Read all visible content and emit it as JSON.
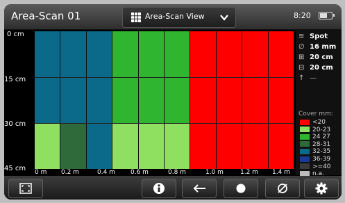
{
  "title": "Area-Scan 01",
  "view_selector": {
    "label": "Area-Scan View"
  },
  "status": {
    "time": "8:20"
  },
  "y_axis": {
    "labels": [
      "0 cm",
      "15 cm",
      "30 cm",
      "45 cm"
    ]
  },
  "x_axis": {
    "labels": [
      "0 m",
      "0.2 m",
      "0.4 m",
      "0.6 m",
      "0.8 m",
      "1.0 m",
      "1.2 m",
      "1.4 m"
    ]
  },
  "info_panel": {
    "mode": "Spot",
    "diameter": "16 mm",
    "height": "20 cm",
    "width": "20 cm",
    "arrow_value": "—"
  },
  "legend": {
    "title": "Cover mm:",
    "items": [
      {
        "label": "<20",
        "color": "#ff0000"
      },
      {
        "label": "20-23",
        "color": "#8fe060"
      },
      {
        "label": "24 27",
        "color": "#2fb52f"
      },
      {
        "label": "28-31",
        "color": "#2f6a3a"
      },
      {
        "label": "32-35",
        "color": "#0b6a8a"
      },
      {
        "label": "36-39",
        "color": "#1a3a9a"
      },
      {
        "label": ">=40",
        "color": "#3a3a3a"
      },
      {
        "label": "n.a.",
        "color": "#bdbdbd"
      }
    ]
  },
  "scan_grid": {
    "columns": 10,
    "rows": 3,
    "cells": [
      [
        "#0b6a8a",
        "#0b6a8a",
        "#0b6a8a",
        "#2fb52f",
        "#2fb52f",
        "#2fb52f",
        "#ff0000",
        "#ff0000",
        "#ff0000",
        "#ff0000"
      ],
      [
        "#0b6a8a",
        "#0b6a8a",
        "#0b6a8a",
        "#2fb52f",
        "#2fb52f",
        "#2fb52f",
        "#ff0000",
        "#ff0000",
        "#ff0000",
        "#ff0000"
      ],
      [
        "#8fe060",
        "#2f6a3a",
        "#0b6a8a",
        "#8fe060",
        "#8fe060",
        "#8fe060",
        "#ff0000",
        "#ff0000",
        "#ff0000",
        "#ff0000"
      ]
    ]
  },
  "toolbar": {
    "buttons": [
      {
        "name": "fullscreen-button",
        "icon": "fullscreen-icon"
      },
      {
        "name": "info-button",
        "icon": "info-icon"
      },
      {
        "name": "back-button",
        "icon": "arrow-left-icon"
      },
      {
        "name": "record-button",
        "icon": "dot-icon"
      },
      {
        "name": "diameter-button",
        "icon": "diameter-icon"
      },
      {
        "name": "settings-button",
        "icon": "gear-icon"
      }
    ]
  }
}
